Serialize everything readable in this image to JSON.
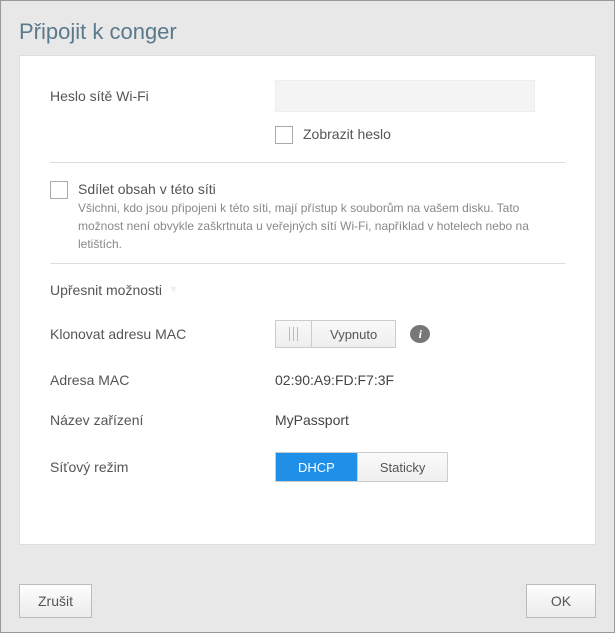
{
  "title": "Připojit k conger",
  "wifi": {
    "password_label": "Heslo sítě Wi-Fi",
    "password_value": "",
    "show_password_label": "Zobrazit heslo"
  },
  "share": {
    "label": "Sdílet obsah v této síti",
    "desc": "Všichni, kdo jsou připojeni k této síti, mají přístup k souborům na vašem disku. Tato možnost není obvykle zaškrtnuta u veřejných sítí Wi-Fi, například v hotelech nebo na letištích."
  },
  "advanced": {
    "section_title": "Upřesnit možnosti",
    "clone_mac_label": "Klonovat adresu MAC",
    "clone_mac_state": "Vypnuto",
    "mac_label": "Adresa MAC",
    "mac_value": "02:90:A9:FD:F7:3F",
    "device_name_label": "Název zařízení",
    "device_name_value": "MyPassport",
    "network_mode_label": "Síťový režim",
    "mode_dhcp": "DHCP",
    "mode_static": "Staticky"
  },
  "buttons": {
    "cancel": "Zrušit",
    "ok": "OK"
  }
}
